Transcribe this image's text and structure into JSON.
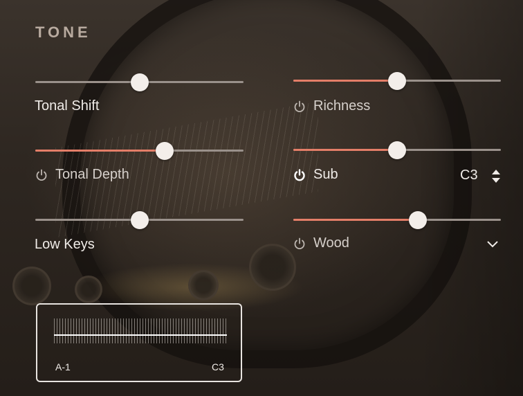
{
  "title": "TONE",
  "accent": "#e47e68",
  "controls": {
    "tonal_shift": {
      "label": "Tonal Shift",
      "value": 0.5,
      "power": false
    },
    "richness": {
      "label": "Richness",
      "value": 0.5,
      "power": "off"
    },
    "tonal_depth": {
      "label": "Tonal Depth",
      "value": 0.62,
      "power": "off"
    },
    "sub": {
      "label": "Sub",
      "value": 0.5,
      "power": "on",
      "note": "C3"
    },
    "low_keys": {
      "label": "Low Keys",
      "value": 0.5,
      "power": false
    },
    "wood": {
      "label": "Wood",
      "value": 0.6,
      "power": "off"
    }
  },
  "range": {
    "low": "A-1",
    "high": "C3"
  },
  "icons": {
    "power": "power-icon",
    "updown": "up-down-arrows-icon",
    "dropdown": "chevron-down-icon"
  }
}
